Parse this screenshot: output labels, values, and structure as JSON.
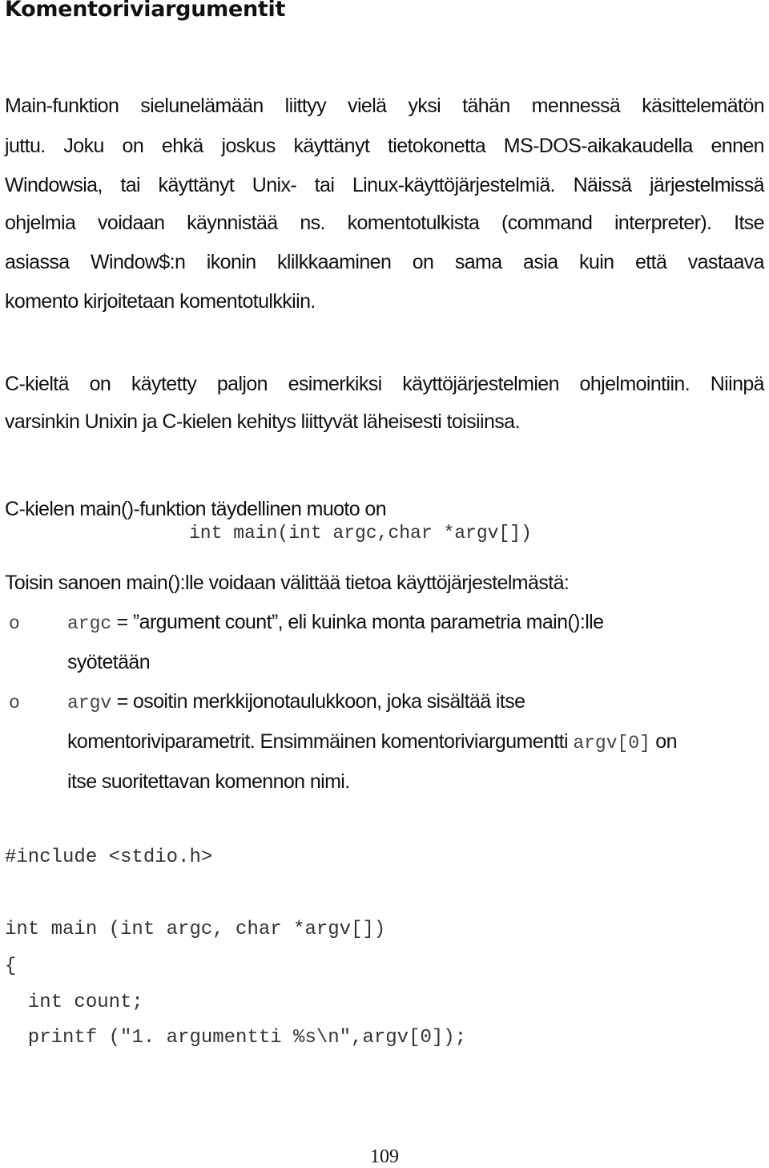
{
  "heading": "Komentoriviargumentit",
  "paragraph1": {
    "lines": [
      "Main-funktion sielunelämään liittyy vielä yksi tähän mennessä käsittelemätön",
      "juttu. Joku on ehkä joskus käyttänyt tietokonetta MS-DOS-aikakaudella ennen",
      "Windowsia, tai käyttänyt Unix- tai Linux-käyttöjärjestelmiä. Näissä järjestelmissä",
      "ohjelmia voidaan käynnistää ns. komentotulkista (command interpreter). Itse",
      "asiassa Window$:n ikonin klilkkaaminen on sama asia kuin että vastaava",
      "komento kirjoitetaan komentotulkkiin."
    ]
  },
  "paragraph2": {
    "lines": [
      "C-kieltä on käytetty paljon esimerkiksi käyttöjärjestelmien ohjelmointiin. Niinpä",
      "varsinkin Unixin ja C-kielen kehitys liittyvät läheisesti toisiinsa."
    ]
  },
  "paragraph3": {
    "intro": "C-kielen main()-funktion täydellinen muoto on",
    "signature": "int main(int argc,char *argv[])",
    "followup": "Toisin sanoen main():lle voidaan välittää tietoa käyttöjärjestelmästä:"
  },
  "bullets": [
    {
      "marker": "o",
      "code": "argc",
      "line1": " = ”argument count”, eli kuinka monta parametria main():lle",
      "line2": "syötetään"
    },
    {
      "marker": "o",
      "code": "argv",
      "line1": " = osoitin merkkijonotaulukkoon, joka sisältää itse",
      "line2_pre": "komentoriviparametrit. Ensimmäinen komentoriviargumentti ",
      "line2_code": "argv[0]",
      "line2_post": " on",
      "line3": "itse suoritettavan komennon nimi."
    }
  ],
  "code_listing": {
    "lines": [
      "#include <stdio.h>",
      "int main (int argc, char *argv[])",
      "{",
      "  int count;",
      "  printf (\"1. argumentti %s\\n\",argv[0]);"
    ]
  },
  "page_number": "109"
}
